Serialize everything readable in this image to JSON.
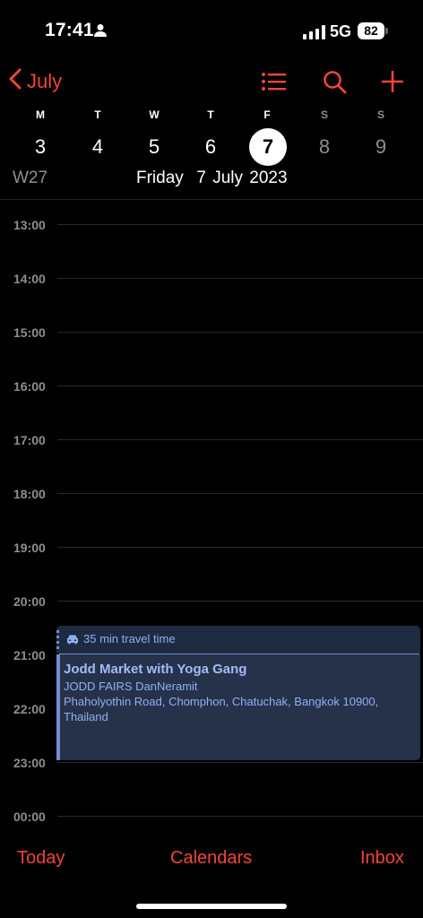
{
  "status": {
    "time": "17:41",
    "network": "5G",
    "battery": "82"
  },
  "nav": {
    "back_label": "July"
  },
  "week": {
    "days": [
      {
        "dow": "M",
        "num": "3"
      },
      {
        "dow": "T",
        "num": "4"
      },
      {
        "dow": "W",
        "num": "5"
      },
      {
        "dow": "T",
        "num": "6"
      },
      {
        "dow": "F",
        "num": "7"
      },
      {
        "dow": "S",
        "num": "8"
      },
      {
        "dow": "S",
        "num": "9"
      }
    ],
    "week_label": "W27",
    "selected_date": "Friday  7 July 2023"
  },
  "timeline": {
    "hours": [
      "13:00",
      "14:00",
      "15:00",
      "16:00",
      "17:00",
      "18:00",
      "19:00",
      "20:00",
      "21:00",
      "22:00",
      "23:00",
      "00:00"
    ]
  },
  "event": {
    "travel": "35 min travel time",
    "title": "Jodd Market with Yoga Gang",
    "calendar": "JODD FAIRS DanNeramit",
    "address": "Phaholyothin Road, Chomphon, Chatuchak, Bangkok 10900, Thailand"
  },
  "tabs": {
    "today": "Today",
    "calendars": "Calendars",
    "inbox": "Inbox"
  },
  "colors": {
    "accent": "#ef4638",
    "event_fill": "#26324a",
    "event_text": "#8fb0f0"
  },
  "icons": [
    "person-icon",
    "cellular-signal-icon",
    "battery-icon",
    "chevron-left-icon",
    "list-icon",
    "search-icon",
    "plus-icon",
    "car-icon"
  ]
}
